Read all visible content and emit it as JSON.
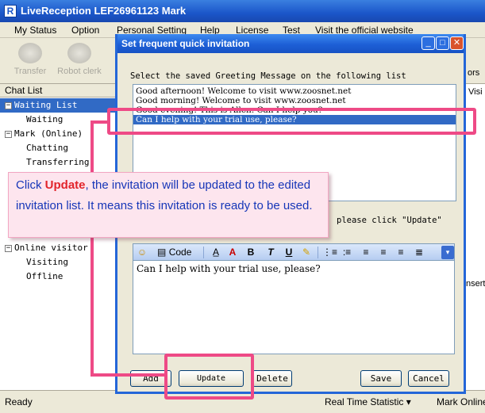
{
  "app": {
    "icon_glyph": "R",
    "title": "LiveReception   LEF26961123 Mark"
  },
  "menu": [
    "My Status",
    "Option",
    "Personal Setting",
    "Help",
    "License",
    "Test",
    "Visit the official website"
  ],
  "toolbar": [
    {
      "label": "Transfer",
      "icon": "transfer-icon"
    },
    {
      "label": "Robot clerk",
      "icon": "robot-icon"
    }
  ],
  "right_fragments": {
    "top": "ors",
    "second": "Visi",
    "third": "nsert"
  },
  "left_panel": {
    "header": "Chat List",
    "items": [
      {
        "label": "Waiting List",
        "box": "−",
        "level": 0,
        "selected": true
      },
      {
        "label": "Waiting",
        "level": 1
      },
      {
        "label": "Mark (Online)",
        "box": "−",
        "level": 0
      },
      {
        "label": "Chatting",
        "level": 1
      },
      {
        "label": "Transferring",
        "level": 1
      },
      {
        "label": "Online visitor",
        "box": "−",
        "level": 0
      },
      {
        "label": "Visiting",
        "level": 1
      },
      {
        "label": "Offline",
        "level": 1
      }
    ]
  },
  "dialog": {
    "title": "Set frequent quick invitation",
    "list_label": "Select the saved Greeting Message on the following list",
    "greetings": [
      "Good afternoon! Welcome to visit www.zoosnet.net",
      "Good morning! Welcome to visit www.zoosnet.net",
      "Good evening! This is Allen. Can I help you?",
      "Can I help with your trial use, please?"
    ],
    "selected_index": 3,
    "hint": "please click \"Update\"",
    "editor_toolbar": {
      "code_label": "Code",
      "bold": "B",
      "italic": "T",
      "underline": "U"
    },
    "editor_text": "Can I help with your trial use, please?",
    "buttons": {
      "add": "Add",
      "update": "Update",
      "delete": "Delete",
      "save": "Save",
      "cancel": "Cancel"
    }
  },
  "callout": {
    "pre": "Click ",
    "keyword": "Update",
    "post": ", the invitation will be updated to the edited invitation list. It means this invitation is ready to be used."
  },
  "statusbar": {
    "left": "Ready",
    "middle": "Real Time Statistic",
    "right": "Mark Online"
  },
  "colors": {
    "accent": "#1b56c9",
    "annotation": "#ee4a86",
    "callout_text": "#1636b8",
    "keyword": "#e2242b"
  }
}
